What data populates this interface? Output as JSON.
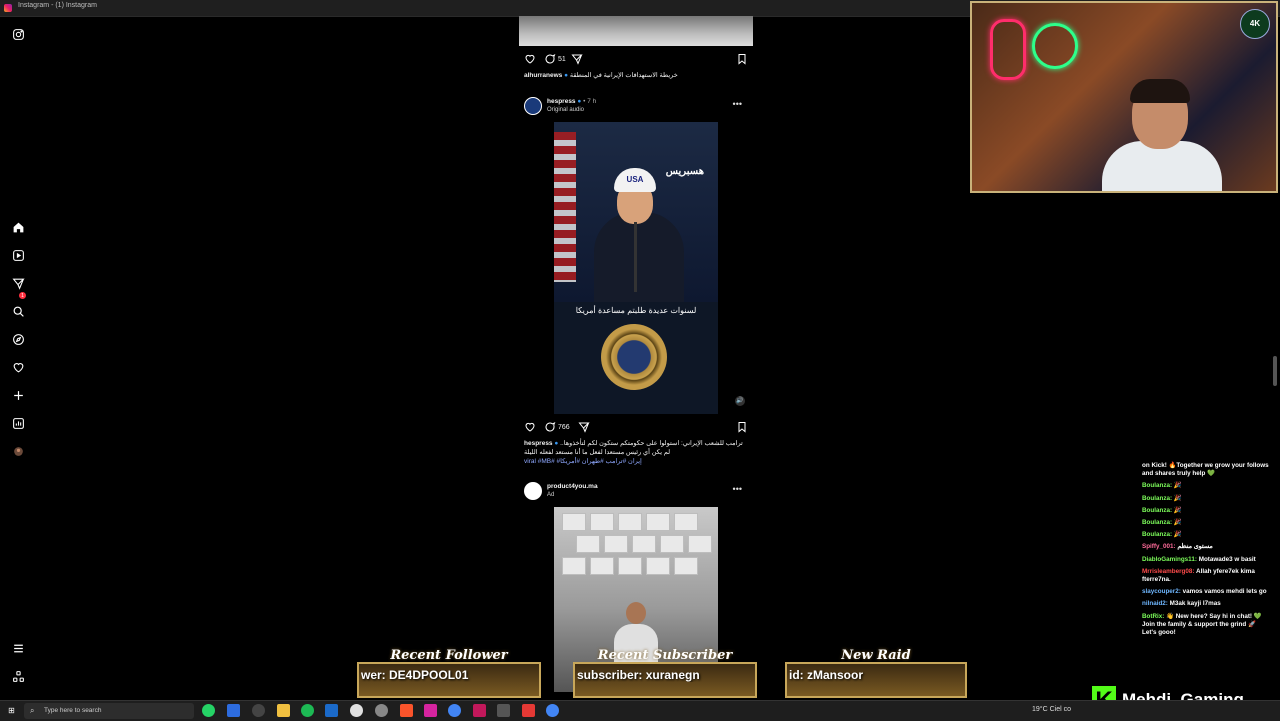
{
  "window": {
    "title": "Instagram - (1) Instagram"
  },
  "sidebar": {
    "items": [
      {
        "name": "instagram-logo-icon"
      },
      {
        "name": "home-icon"
      },
      {
        "name": "reels-icon"
      },
      {
        "name": "messages-icon",
        "badge": "1"
      },
      {
        "name": "search-icon"
      },
      {
        "name": "explore-icon"
      },
      {
        "name": "notifications-icon"
      },
      {
        "name": "create-icon"
      },
      {
        "name": "dashboard-icon"
      },
      {
        "name": "profile-avatar"
      },
      {
        "name": "menu-icon"
      },
      {
        "name": "also-from-meta-icon"
      }
    ]
  },
  "feed": {
    "post1": {
      "comments": "51",
      "caption_user": "alhurranews",
      "caption_text": "خريطة الاستهدافات الإيرانية في المنطقة"
    },
    "post2": {
      "username": "hespress",
      "time": "• 7 h",
      "audio": "Original audio",
      "watermark": "هسبريس",
      "subtitle": "لسنوات عديدة طلبتم مساعدة أمريكا",
      "hat_text": "USA",
      "comments": "766",
      "caption_user": "hespress",
      "caption_text": "ترامب للشعب الإيراني: استولوا على حكومتكم ستكون لكم لتأخذوها.. لم يكن أي رئيس مستعدا لفعل ما أنا مستعد لفعله الليلة",
      "caption_tags": "viral #MB# #إيران #ترامب #طهران #أمريكا"
    },
    "post3": {
      "username": "product4you.ma",
      "label": "Ad"
    }
  },
  "overlay": {
    "badge": "4K",
    "chat": [
      {
        "user": "",
        "text": "on Kick! 🔥Together we grow your follows and shares truly help 💚",
        "color": "#ffffff"
      },
      {
        "user": "Boulanza:",
        "text": "🎉",
        "color": "#7cfc5a"
      },
      {
        "user": "Boulanza:",
        "text": "🎉",
        "color": "#7cfc5a"
      },
      {
        "user": "Boulanza:",
        "text": "🎉",
        "color": "#7cfc5a"
      },
      {
        "user": "Boulanza:",
        "text": "🎉",
        "color": "#7cfc5a"
      },
      {
        "user": "Boulanza:",
        "text": "🎉",
        "color": "#7cfc5a"
      },
      {
        "user": "Spiffy_001:",
        "text": "مستوى منظم",
        "color": "#ff6b9a"
      },
      {
        "user": "DiabloGamings11:",
        "text": "Motawade3 w basit",
        "color": "#7cfc5a"
      },
      {
        "user": "Mrrisleamberg08:",
        "text": "Allah yfere7ek kima fterre7na.",
        "color": "#ff4b4b"
      },
      {
        "user": "slaycouper2:",
        "text": "vamos vamos mehdi lets go",
        "color": "#6fb7ff"
      },
      {
        "user": "nilnaid2:",
        "text": "M3ak kayji l7mas",
        "color": "#6fb7ff"
      },
      {
        "user": "BotRix:",
        "text": "👋 New here? Say hi in chat! 💚 Join the family & support the grind 🚀 Let's gooo!",
        "color": "#7cfc5a"
      }
    ],
    "streamer": "Mehdi_Gaming",
    "kick_letter": "K",
    "panels": [
      {
        "title": "Recent Follower",
        "value": "wer: DE4DPOOL01"
      },
      {
        "title": "Recent Subscriber",
        "value": "subscriber: xuranegn"
      },
      {
        "title": "New Raid",
        "value": "id: zMansoor"
      }
    ]
  },
  "taskbar": {
    "search_placeholder": "Type here to search",
    "weather": "19°C  Ciel co"
  }
}
